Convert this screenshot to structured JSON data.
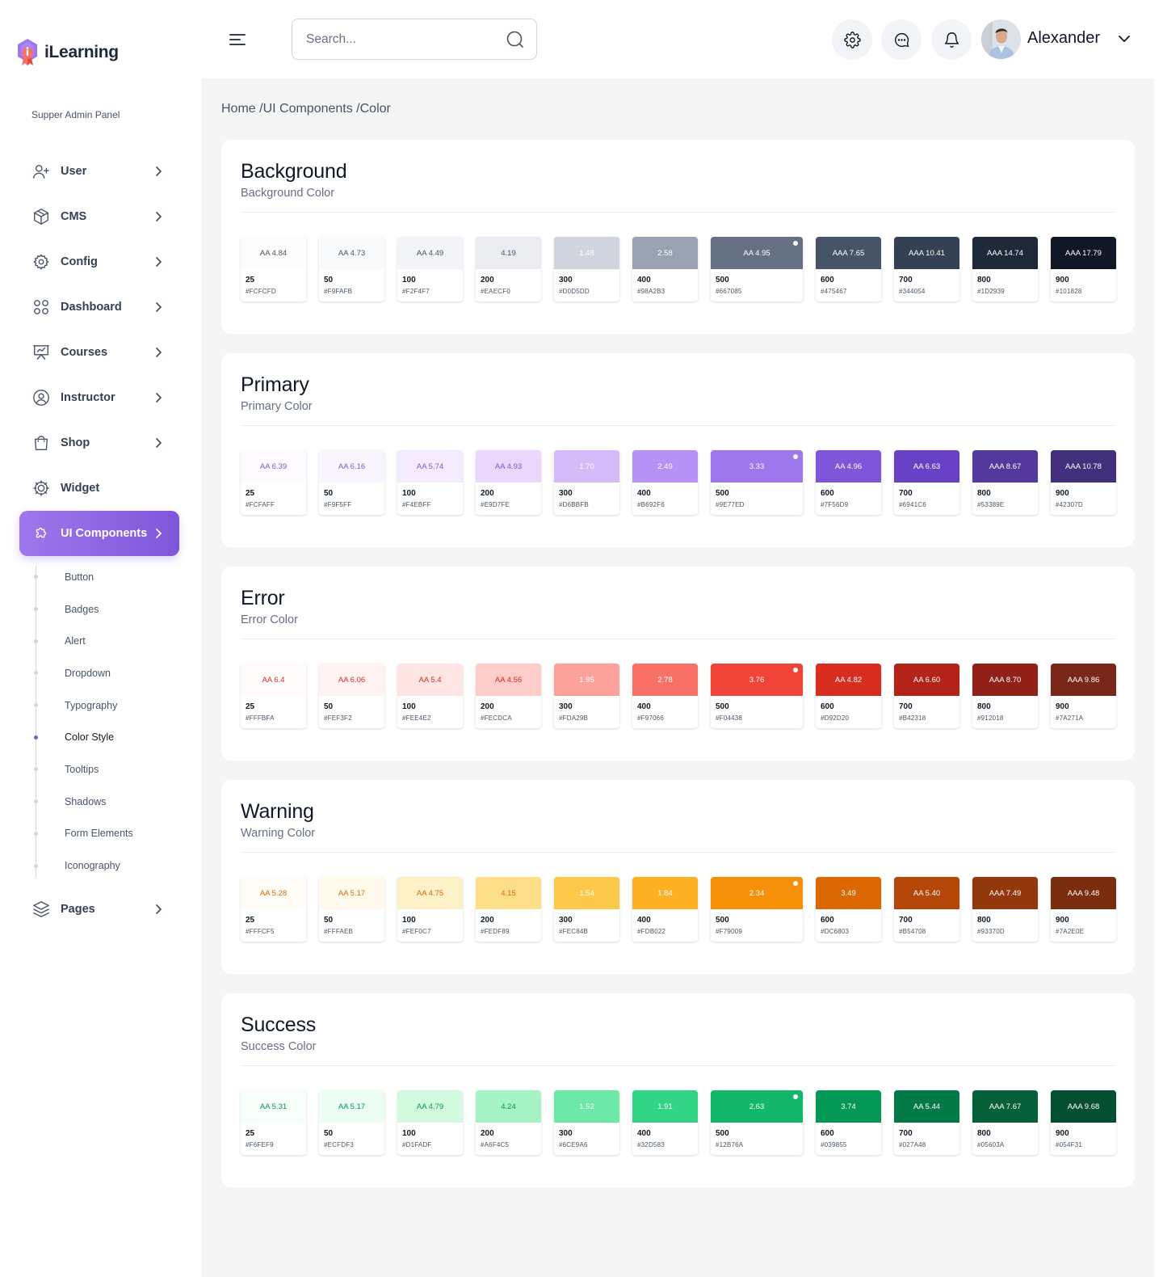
{
  "brand": {
    "name": "iLearning"
  },
  "sidebar": {
    "panel_label": "Supper Admin Panel",
    "items": [
      {
        "label": "User",
        "icon": "user-plus-icon",
        "chevron": true
      },
      {
        "label": "CMS",
        "icon": "cube-icon",
        "chevron": true
      },
      {
        "label": "Config",
        "icon": "gear-icon",
        "chevron": true
      },
      {
        "label": "Dashboard",
        "icon": "grid-icon",
        "chevron": true
      },
      {
        "label": "Courses",
        "icon": "presentation-icon",
        "chevron": true
      },
      {
        "label": "Instructor",
        "icon": "user-circle-icon",
        "chevron": true
      },
      {
        "label": "Shop",
        "icon": "shopping-bag-icon",
        "chevron": true
      },
      {
        "label": "Widget",
        "icon": "cog-widget-icon",
        "chevron": false
      },
      {
        "label": "UI Components",
        "icon": "puzzle-icon",
        "chevron": true,
        "active": true
      }
    ],
    "sub_items": [
      {
        "label": "Button"
      },
      {
        "label": "Badges"
      },
      {
        "label": "Alert"
      },
      {
        "label": "Dropdown"
      },
      {
        "label": "Typography"
      },
      {
        "label": "Color Style",
        "active": true
      },
      {
        "label": "Tooltips"
      },
      {
        "label": "Shadows"
      },
      {
        "label": "Form Elements"
      },
      {
        "label": "Iconography"
      }
    ],
    "after_items": [
      {
        "label": "Pages",
        "icon": "layers-icon",
        "chevron": true
      }
    ]
  },
  "header": {
    "search_placeholder": "Search...",
    "user_name": "Alexander",
    "buttons": [
      "settings-icon",
      "chat-icon",
      "bell-icon"
    ]
  },
  "breadcrumb": "Home /UI Components /Color",
  "palettes": [
    {
      "title": "Background",
      "subtitle": "Background Color",
      "swatches": [
        {
          "name": "25",
          "hex": "#FCFCFD",
          "contrast": "AA 4.84",
          "text": "#475467"
        },
        {
          "name": "50",
          "hex": "#F9FAFB",
          "contrast": "AA 4.73",
          "text": "#475467"
        },
        {
          "name": "100",
          "hex": "#F2F4F7",
          "contrast": "AA 4.49",
          "text": "#475467"
        },
        {
          "name": "200",
          "hex": "#EAECF0",
          "contrast": "4.19",
          "text": "#475467"
        },
        {
          "name": "300",
          "hex": "#D0D5DD",
          "contrast": "1.48",
          "text": "#FFFFFF"
        },
        {
          "name": "400",
          "hex": "#98A2B3",
          "contrast": "2.58",
          "text": "#FFFFFF"
        },
        {
          "name": "500",
          "hex": "#667085",
          "contrast": "AA 4.95",
          "text": "#FFFFFF",
          "selected": true
        },
        {
          "name": "600",
          "hex": "#475467",
          "contrast": "AAA 7.65",
          "text": "#FFFFFF"
        },
        {
          "name": "700",
          "hex": "#344054",
          "contrast": "AAA 10.41",
          "text": "#FFFFFF"
        },
        {
          "name": "800",
          "hex": "#1D2939",
          "contrast": "AAA 14.74",
          "text": "#FFFFFF"
        },
        {
          "name": "900",
          "hex": "#101828",
          "contrast": "AAA 17.79",
          "text": "#FFFFFF"
        }
      ]
    },
    {
      "title": "Primary",
      "subtitle": "Primary Color",
      "swatches": [
        {
          "name": "25",
          "hex": "#FCFAFF",
          "contrast": "AA 6.39",
          "text": "#7F56D9"
        },
        {
          "name": "50",
          "hex": "#F9F5FF",
          "contrast": "AA 6.16",
          "text": "#7F56D9"
        },
        {
          "name": "100",
          "hex": "#F4EBFF",
          "contrast": "AA 5.74",
          "text": "#7F56D9"
        },
        {
          "name": "200",
          "hex": "#E9D7FE",
          "contrast": "AA 4.93",
          "text": "#7F56D9"
        },
        {
          "name": "300",
          "hex": "#D6BBFB",
          "contrast": "1.70",
          "text": "#FFFFFF"
        },
        {
          "name": "400",
          "hex": "#B692F6",
          "contrast": "2.49",
          "text": "#FFFFFF"
        },
        {
          "name": "500",
          "hex": "#9E77ED",
          "contrast": "3.33",
          "text": "#FFFFFF",
          "selected": true
        },
        {
          "name": "600",
          "hex": "#7F56D9",
          "contrast": "AA 4.96",
          "text": "#FFFFFF"
        },
        {
          "name": "700",
          "hex": "#6941C6",
          "contrast": "AA 6.63",
          "text": "#FFFFFF"
        },
        {
          "name": "800",
          "hex": "#53389E",
          "contrast": "AAA 8.67",
          "text": "#FFFFFF"
        },
        {
          "name": "900",
          "hex": "#42307D",
          "contrast": "AAA 10.78",
          "text": "#FFFFFF"
        }
      ]
    },
    {
      "title": "Error",
      "subtitle": "Error Color",
      "swatches": [
        {
          "name": "25",
          "hex": "#FFFBFA",
          "contrast": "AA 6.4",
          "text": "#D92D20"
        },
        {
          "name": "50",
          "hex": "#FEF3F2",
          "contrast": "AA 6.06",
          "text": "#D92D20"
        },
        {
          "name": "100",
          "hex": "#FEE4E2",
          "contrast": "AA 5.4",
          "text": "#D92D20"
        },
        {
          "name": "200",
          "hex": "#FECDCA",
          "contrast": "AA 4.56",
          "text": "#D92D20"
        },
        {
          "name": "300",
          "hex": "#FDA29B",
          "contrast": "1.95",
          "text": "#FFFFFF"
        },
        {
          "name": "400",
          "hex": "#F97066",
          "contrast": "2.78",
          "text": "#FFFFFF"
        },
        {
          "name": "500",
          "hex": "#F04438",
          "contrast": "3.76",
          "text": "#FFFFFF",
          "selected": true
        },
        {
          "name": "600",
          "hex": "#D92D20",
          "contrast": "AA 4.82",
          "text": "#FFFFFF"
        },
        {
          "name": "700",
          "hex": "#B42318",
          "contrast": "AA 6.60",
          "text": "#FFFFFF"
        },
        {
          "name": "800",
          "hex": "#912018",
          "contrast": "AAA 8.70",
          "text": "#FFFFFF"
        },
        {
          "name": "900",
          "hex": "#7A271A",
          "contrast": "AAA 9.86",
          "text": "#FFFFFF"
        }
      ]
    },
    {
      "title": "Warning",
      "subtitle": "Warning Color",
      "swatches": [
        {
          "name": "25",
          "hex": "#FFFCF5",
          "contrast": "AA 5.28",
          "text": "#DC6803"
        },
        {
          "name": "50",
          "hex": "#FFFAEB",
          "contrast": "AA 5.17",
          "text": "#DC6803"
        },
        {
          "name": "100",
          "hex": "#FEF0C7",
          "contrast": "AA 4.75",
          "text": "#DC6803"
        },
        {
          "name": "200",
          "hex": "#FEDF89",
          "contrast": "4.15",
          "text": "#DC6803"
        },
        {
          "name": "300",
          "hex": "#FEC84B",
          "contrast": "1.54",
          "text": "#FFFFFF"
        },
        {
          "name": "400",
          "hex": "#FDB022",
          "contrast": "1.84",
          "text": "#FFFFFF"
        },
        {
          "name": "500",
          "hex": "#F79009",
          "contrast": "2.34",
          "text": "#FFFFFF",
          "selected": true
        },
        {
          "name": "600",
          "hex": "#DC6803",
          "contrast": "3.49",
          "text": "#FFFFFF"
        },
        {
          "name": "700",
          "hex": "#B54708",
          "contrast": "AA 5.40",
          "text": "#FFFFFF"
        },
        {
          "name": "800",
          "hex": "#93370D",
          "contrast": "AAA 7.49",
          "text": "#FFFFFF"
        },
        {
          "name": "900",
          "hex": "#7A2E0E",
          "contrast": "AAA 9.48",
          "text": "#FFFFFF"
        }
      ]
    },
    {
      "title": "Success",
      "subtitle": "Success Color",
      "swatches": [
        {
          "name": "25",
          "hex": "#F6FEF9",
          "contrast": "AA 5.31",
          "text": "#039855"
        },
        {
          "name": "50",
          "hex": "#ECFDF3",
          "contrast": "AA 5.17",
          "text": "#039855"
        },
        {
          "name": "100",
          "hex": "#D1FADF",
          "contrast": "AA 4.79",
          "text": "#039855"
        },
        {
          "name": "200",
          "hex": "#A6F4C5",
          "contrast": "4.24",
          "text": "#039855"
        },
        {
          "name": "300",
          "hex": "#6CE9A6",
          "contrast": "1.52",
          "text": "#FFFFFF"
        },
        {
          "name": "400",
          "hex": "#32D583",
          "contrast": "1.91",
          "text": "#FFFFFF"
        },
        {
          "name": "500",
          "hex": "#12B76A",
          "contrast": "2.63",
          "text": "#FFFFFF",
          "selected": true
        },
        {
          "name": "600",
          "hex": "#039855",
          "contrast": "3.74",
          "text": "#FFFFFF"
        },
        {
          "name": "700",
          "hex": "#027A48",
          "contrast": "AA 5.44",
          "text": "#FFFFFF"
        },
        {
          "name": "800",
          "hex": "#05603A",
          "contrast": "AAA 7.67",
          "text": "#FFFFFF"
        },
        {
          "name": "900",
          "hex": "#054F31",
          "contrast": "AAA 9.68",
          "text": "#FFFFFF"
        }
      ]
    }
  ]
}
